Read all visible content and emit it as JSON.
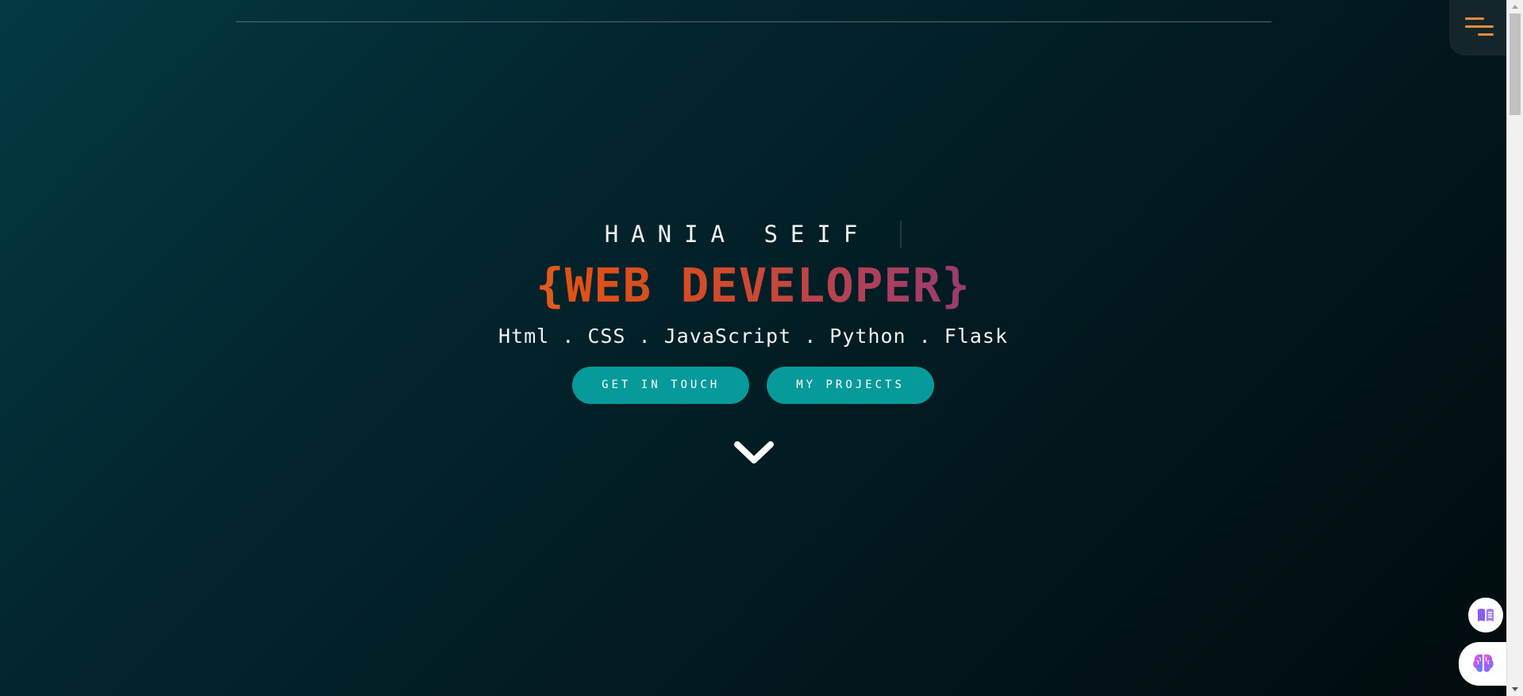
{
  "header": {
    "menu_icon": "hamburger-menu-icon"
  },
  "hero": {
    "name": "HANIA SEIF",
    "role_open": "{",
    "role": "WEB DEVELOPER",
    "role_close": "}",
    "skills": "Html . CSS . JavaScript . Python . Flask",
    "get_in_touch_label": "GET IN TOUCH",
    "my_projects_label": "MY PROJECTS",
    "scroll_icon": "chevron-down-icon"
  },
  "floating": {
    "reader_icon": "book-icon",
    "assistant_icon": "brain-icon"
  },
  "colors": {
    "background_start": "#033a44",
    "background_end": "#010b0d",
    "accent_orange": "#e15214",
    "accent_magenta": "#9c3d6a",
    "button_teal": "#079a9a",
    "text": "#f2f2f2"
  }
}
